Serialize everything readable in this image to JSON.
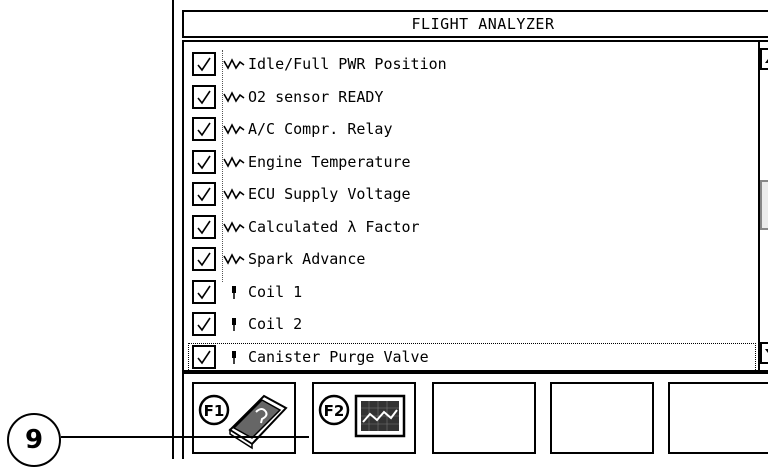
{
  "window": {
    "title": "FLIGHT ANALYZER"
  },
  "list": {
    "items": [
      {
        "label": "Idle/Full PWR Position",
        "checked": true,
        "icon": "wave-signal-icon"
      },
      {
        "label": "O2 sensor READY",
        "checked": true,
        "icon": "wave-signal-icon"
      },
      {
        "label": "A/C Compr. Relay",
        "checked": true,
        "icon": "wave-signal-icon"
      },
      {
        "label": "Engine Temperature",
        "checked": true,
        "icon": "wave-signal-icon"
      },
      {
        "label": "ECU Supply Voltage",
        "checked": true,
        "icon": "wave-signal-icon"
      },
      {
        "label": "Calculated λ Factor",
        "checked": true,
        "icon": "wave-signal-icon"
      },
      {
        "label": "Spark Advance",
        "checked": true,
        "icon": "wave-signal-icon"
      },
      {
        "label": "Coil 1",
        "checked": true,
        "icon": "actuator-pin-icon"
      },
      {
        "label": "Coil 2",
        "checked": true,
        "icon": "actuator-pin-icon"
      },
      {
        "label": "Canister Purge Valve",
        "checked": true,
        "icon": "actuator-pin-icon"
      }
    ],
    "scroll_position": 0.5
  },
  "function_keys": [
    {
      "key": "F1",
      "icon": "help-book-icon"
    },
    {
      "key": "F2",
      "icon": "graph-screen-icon"
    },
    {
      "key": "",
      "icon": ""
    },
    {
      "key": "",
      "icon": ""
    },
    {
      "key": "",
      "icon": ""
    }
  ],
  "callout": {
    "number": "9"
  }
}
